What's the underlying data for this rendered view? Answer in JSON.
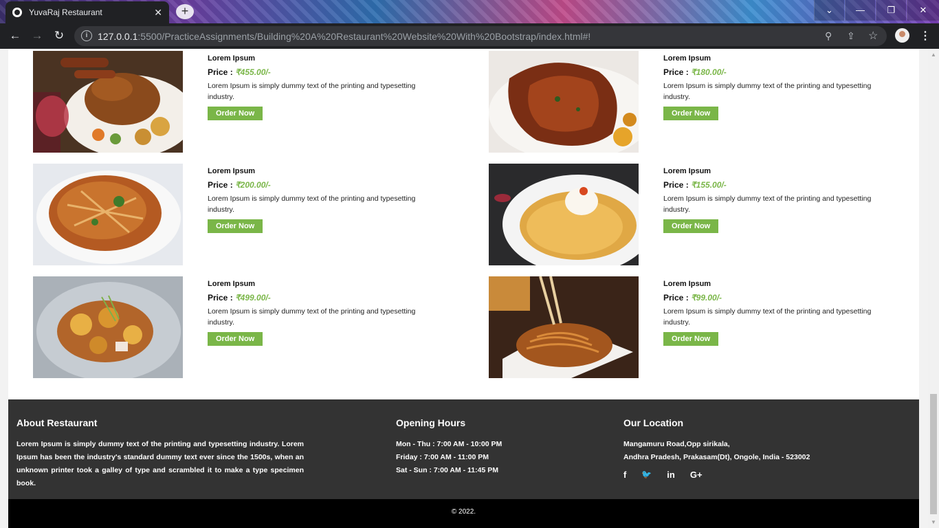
{
  "browser": {
    "tab_title": "YuvaRaj Restaurant",
    "tab_close": "✕",
    "new_tab": "+",
    "url_host": "127.0.0.1",
    "url_rest": ":5500/PracticeAssignments/Building%20A%20Restaurant%20Website%20With%20Bootstrap/index.html#!",
    "back": "←",
    "forward": "→",
    "reload": "↻",
    "info": "i",
    "zoom_icon": "⚲",
    "share_icon": "⇪",
    "star_icon": "☆",
    "menu": "⋮",
    "win_chevron": "⌄",
    "win_min": "—",
    "win_restore": "❐",
    "win_close": "✕"
  },
  "menu_items": [
    {
      "name": "Lorem Ipsum",
      "price_label": "Price : ",
      "price": "₹455.00/-",
      "desc": "Lorem Ipsum is simply dummy text of the printing and typesetting industry.",
      "button": "Order Now"
    },
    {
      "name": "Lorem Ipsum",
      "price_label": "Price : ",
      "price": "₹180.00/-",
      "desc": "Lorem Ipsum is simply dummy text of the printing and typesetting industry.",
      "button": "Order Now"
    },
    {
      "name": "Lorem Ipsum",
      "price_label": "Price : ",
      "price": "₹200.00/-",
      "desc": "Lorem Ipsum is simply dummy text of the printing and typesetting industry.",
      "button": "Order Now"
    },
    {
      "name": "Lorem Ipsum",
      "price_label": "Price : ",
      "price": "₹155.00/-",
      "desc": "Lorem Ipsum is simply dummy text of the printing and typesetting industry.",
      "button": "Order Now"
    },
    {
      "name": "Lorem Ipsum",
      "price_label": "Price : ",
      "price": "₹499.00/-",
      "desc": "Lorem Ipsum is simply dummy text of the printing and typesetting industry.",
      "button": "Order Now"
    },
    {
      "name": "Lorem Ipsum",
      "price_label": "Price : ",
      "price": "₹99.00/-",
      "desc": "Lorem Ipsum is simply dummy text of the printing and typesetting industry.",
      "button": "Order Now"
    }
  ],
  "footer": {
    "about": {
      "heading": "About Restaurant",
      "text": "Lorem Ipsum is simply dummy text of the printing and typesetting industry. Lorem Ipsum has been the industry's standard dummy text ever since the 1500s, when an unknown printer took a galley of type and scrambled it to make a type specimen book."
    },
    "hours": {
      "heading": "Opening Hours",
      "lines": [
        "Mon - Thu : 7:00 AM - 10:00 PM",
        "Friday : 7:00 AM - 11:00 PM",
        "Sat - Sun : 7:00 AM - 11:45 PM"
      ]
    },
    "location": {
      "heading": "Our Location",
      "line1": "Mangamuru Road,Opp sirikala,",
      "line2": "Andhra Pradesh, Prakasam(Dt), Ongole, India - 523002",
      "social": [
        "f",
        "🐦",
        "in",
        "G+"
      ]
    },
    "copyright": "© 2022."
  },
  "colors": {
    "accent_green": "#7ab648",
    "footer_bg": "#333333",
    "copyright_bg": "#000000"
  }
}
